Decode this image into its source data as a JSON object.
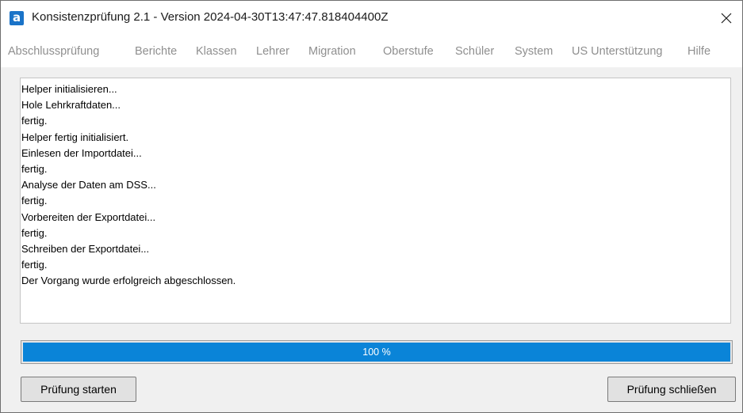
{
  "window": {
    "title": "Konsistenzprüfung 2.1 - Version 2024-04-30T13:47:47.818404400Z",
    "app_icon_letter": "a",
    "close_icon": "close-icon"
  },
  "menu": {
    "items": [
      "Abschlussprüfung",
      "Berichte",
      "Klassen",
      "Lehrer",
      "Migration",
      "Oberstufe",
      "Schüler",
      "System",
      "US Unterstützung",
      "Hilfe"
    ]
  },
  "log": {
    "lines": [
      "Helper initialisieren...",
      "Hole Lehrkraftdaten...",
      "fertig.",
      "Helper fertig initialisiert.",
      "Einlesen der Importdatei...",
      "fertig.",
      "Analyse der Daten am DSS...",
      "fertig.",
      "Vorbereiten der Exportdatei...",
      "fertig.",
      "Schreiben der Exportdatei...",
      "fertig.",
      "Der Vorgang wurde erfolgreich abgeschlossen."
    ]
  },
  "progress": {
    "value_percent": 100,
    "label": "100 %",
    "color": "#0a84d8"
  },
  "buttons": {
    "start_label": "Prüfung starten",
    "close_label": "Prüfung schließen"
  }
}
